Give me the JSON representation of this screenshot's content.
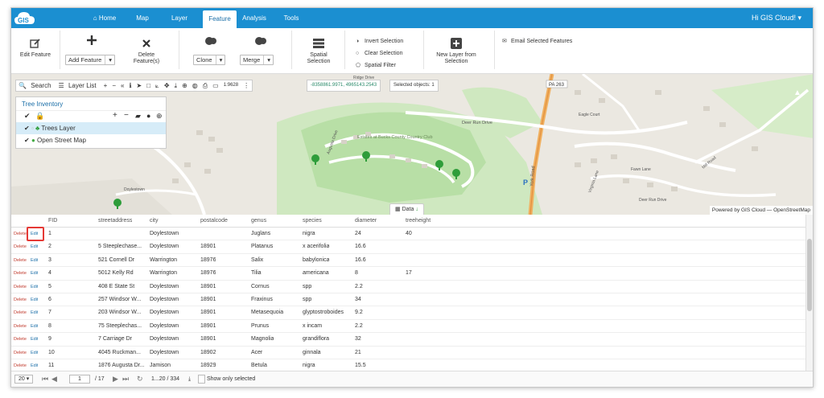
{
  "app": {
    "logo_text": "GIS",
    "user": "Hi GIS Cloud! ▾"
  },
  "nav": [
    "Home",
    "Map",
    "Layer",
    "Feature",
    "Analysis",
    "Tools"
  ],
  "toolbar": {
    "edit_feature": "Edit Feature",
    "add_feature": "Add Feature",
    "delete_features": "Delete Feature(s)",
    "clone": "Clone",
    "merge": "Merge",
    "spatial_selection": "Spatial Selection",
    "invert_selection": "Invert Selection",
    "clear_selection": "Clear Selection",
    "spatial_filter": "Spatial Filter",
    "new_layer": "New Layer from Selection",
    "email": "Email Selected Features"
  },
  "mapbar": {
    "search": "Search",
    "layer_list": "Layer List",
    "scale": "1:9628",
    "coords": "-8358861.9971, 4965143.2543",
    "selected": "Selected objects: 1"
  },
  "inventory": {
    "title": "Tree Inventory",
    "layers": [
      "Trees Layer",
      "Open Street Map"
    ]
  },
  "map": {
    "attribution": "Powered by GIS Cloud — OpenStreetMap",
    "data_tab": "Data",
    "labels": [
      "PA 263",
      "Deer Run Drive",
      "Estates at Bucks County Country Club",
      "Augusta Drive",
      "York Road",
      "Doylestown",
      "Eagle Court",
      "Mill Road",
      "Virginia Lane",
      "Fawn Lane",
      "Ridge Drive",
      "Deer Run Drive"
    ]
  },
  "table": {
    "columns": [
      "FID",
      "streetaddress",
      "city",
      "postalcode",
      "genus",
      "species",
      "diameter",
      "treeheight"
    ],
    "action_delete": "Delete",
    "action_edit": "Edit",
    "rows": [
      [
        "1",
        "",
        "Doylestown",
        "",
        "Juglans",
        "nigra",
        "24",
        "40"
      ],
      [
        "2",
        "5 Steeplechase...",
        "Doylestown",
        "18901",
        "Platanus",
        "x acerifolia",
        "16.6",
        ""
      ],
      [
        "3",
        "521 Cornell Dr",
        "Warrington",
        "18976",
        "Salix",
        "babylonica",
        "16.6",
        ""
      ],
      [
        "4",
        "5012 Kelly Rd",
        "Warrington",
        "18976",
        "Tilia",
        "americana",
        "8",
        "17"
      ],
      [
        "5",
        "408 E State St",
        "Doylestown",
        "18901",
        "Cornus",
        "spp",
        "2.2",
        ""
      ],
      [
        "6",
        "257 Windsor W...",
        "Doylestown",
        "18901",
        "Fraxinus",
        "spp",
        "34",
        ""
      ],
      [
        "7",
        "203 Windsor W...",
        "Doylestown",
        "18901",
        "Metasequoia",
        "glyptostroboides",
        "9.2",
        ""
      ],
      [
        "8",
        "75 Steeplechas...",
        "Doylestown",
        "18901",
        "Prunus",
        "x incam",
        "2.2",
        ""
      ],
      [
        "9",
        "7 Carriage Dr",
        "Doylestown",
        "18901",
        "Magnolia",
        "grandiflora",
        "32",
        ""
      ],
      [
        "10",
        "4045 Ruckman...",
        "Doylestown",
        "18902",
        "Acer",
        "ginnala",
        "21",
        ""
      ],
      [
        "11",
        "1876 Augusta Dr...",
        "Jamison",
        "18929",
        "Betula",
        "nigra",
        "15.5",
        ""
      ]
    ]
  },
  "pager": {
    "page_size": "20",
    "page": "1",
    "total_pages": "/ 17",
    "range": "1...20 / 334",
    "show_selected": "Show only selected"
  },
  "colors": {
    "topbar": "#1b8fd1",
    "highlight": "#e53935",
    "tree": "#2e9d3a"
  }
}
